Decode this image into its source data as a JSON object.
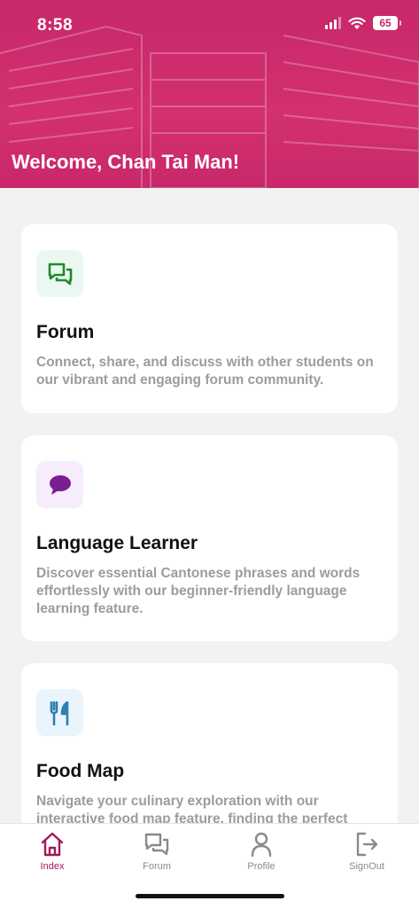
{
  "status_bar": {
    "time": "8:58",
    "battery": "65"
  },
  "header": {
    "welcome": "Welcome, Chan Tai Man!"
  },
  "cards": [
    {
      "title": "Forum",
      "description": "Connect, share, and discuss with other students on our vibrant and engaging forum community.",
      "icon": "chat-bubbles-icon",
      "icon_color": "#1f8a2a",
      "icon_bg": "#ebf8f1"
    },
    {
      "title": "Language Learner",
      "description": "Discover essential Cantonese phrases and words effortlessly with our beginner-friendly language learning feature.",
      "icon": "speech-bubble-icon",
      "icon_color": "#7b1e8f",
      "icon_bg": "#f7ecfb"
    },
    {
      "title": "Food Map",
      "description": "Navigate your culinary exploration with our interactive food map feature, finding the perfect",
      "icon": "fork-knife-icon",
      "icon_color": "#2f7fb0",
      "icon_bg": "#e9f4fc"
    }
  ],
  "tabbar": {
    "items": [
      {
        "label": "Index",
        "icon": "home-icon",
        "active": true
      },
      {
        "label": "Forum",
        "icon": "chat-bubbles-icon",
        "active": false
      },
      {
        "label": "Profile",
        "icon": "user-icon",
        "active": false
      },
      {
        "label": "SignOut",
        "icon": "sign-out-icon",
        "active": false
      }
    ],
    "active_color": "#a1195a"
  },
  "colors": {
    "header": "#cc2a6c",
    "background": "#f2f2f2"
  }
}
